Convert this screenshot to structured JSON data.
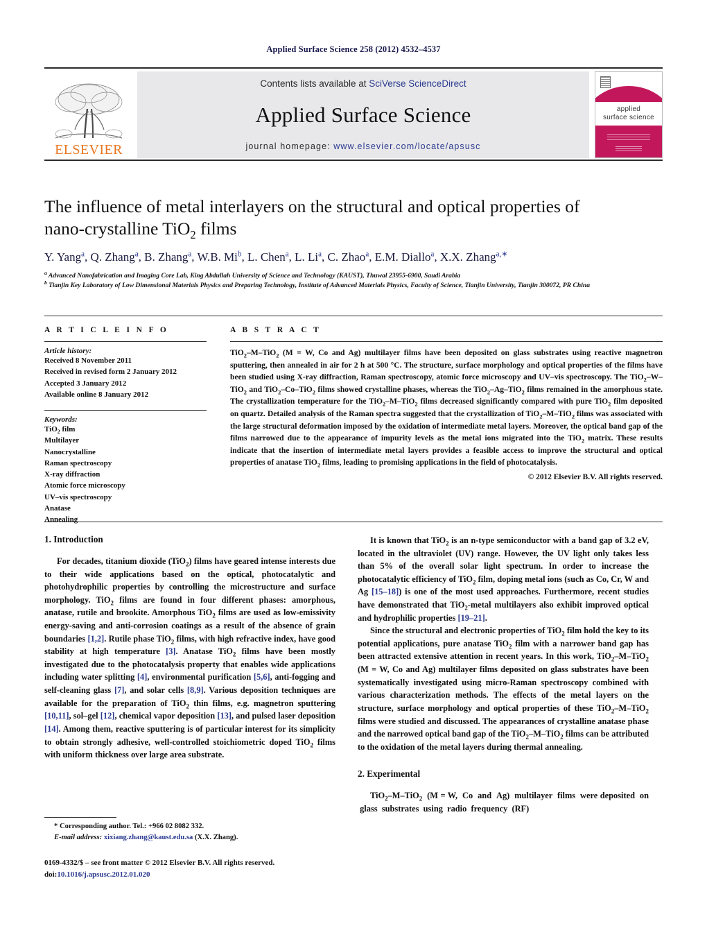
{
  "running_head": "Applied Surface Science 258 (2012) 4532–4537",
  "masthead": {
    "publisher_wordmark": "ELSEVIER",
    "contents_prefix": "Contents lists available at ",
    "contents_link": "SciVerse ScienceDirect",
    "journal_name": "Applied Surface Science",
    "homepage_prefix": "journal homepage: ",
    "homepage_url": "www.elsevier.com/locate/apsusc",
    "cover_title_line1": "applied",
    "cover_title_line2": "surface science"
  },
  "article": {
    "title_line1": "The influence of metal interlayers on the structural and optical properties of",
    "title_line2_pre": "nano-crystalline TiO",
    "title_line2_sub": "2",
    "title_line2_post": " films",
    "authors": "Y. Yang a, Q. Zhang a, B. Zhang a, W.B. Mi b, L. Chen a, L. Li a, C. Zhao a, E.M. Diallo a, X.X. Zhang a,*",
    "affiliation_a": "Advanced Nanofabrication and Imaging Core Lab, King Abdullah University of Science and Technology (KAUST), Thuwal 23955-6900, Saudi Arabia",
    "affiliation_b": "Tianjin Key Laboratory of Low Dimensional Materials Physics and Preparing Technology, Institute of Advanced Materials Physics, Faculty of Science, Tianjin University, Tianjin 300072, PR China"
  },
  "article_info": {
    "heading": "A R T I C L E   I N F O",
    "history_label": "Article history:",
    "history": [
      "Received 8 November 2011",
      "Received in revised form 2 January 2012",
      "Accepted 3 January 2012",
      "Available online 8 January 2012"
    ],
    "keywords_label": "Keywords:",
    "keywords": [
      "TiO2 film",
      "Multilayer",
      "Nanocrystalline",
      "Raman spectroscopy",
      "X-ray diffraction",
      "Atomic force microscopy",
      "UV–vis spectroscopy",
      "Anatase",
      "Annealing"
    ]
  },
  "abstract": {
    "heading": "A B S T R A C T",
    "text": "TiO2–M–TiO2 (M = W, Co and Ag) multilayer films have been deposited on glass substrates using reactive magnetron sputtering, then annealed in air for 2 h at 500 °C. The structure, surface morphology and optical properties of the films have been studied using X-ray diffraction, Raman spectroscopy, atomic force microscopy and UV–vis spectroscopy. The TiO2–W–TiO2 and TiO2–Co–TiO2 films showed crystalline phases, whereas the TiO2–Ag–TiO2 films remained in the amorphous state. The crystallization temperature for the TiO2–M–TiO2 films decreased significantly compared with pure TiO2 film deposited on quartz. Detailed analysis of the Raman spectra suggested that the crystallization of TiO2–M–TiO2 films was associated with the large structural deformation imposed by the oxidation of intermediate metal layers. Moreover, the optical band gap of the films narrowed due to the appearance of impurity levels as the metal ions migrated into the TiO2 matrix. These results indicate that the insertion of intermediate metal layers provides a feasible access to improve the structural and optical properties of anatase TiO2 films, leading to promising applications in the field of photocatalysis.",
    "copyright": "© 2012 Elsevier B.V. All rights reserved."
  },
  "sections": {
    "introduction_heading": "1.  Introduction",
    "experimental_heading": "2.  Experimental",
    "intro_para1": "For decades, titanium dioxide (TiO2) films have geared intense interests due to their wide applications based on the optical, photocatalytic and photohydrophilic properties by controlling the microstructure and surface morphology. TiO2 films are found in four different phases: amorphous, anatase, rutile and brookite. Amorphous TiO2 films are used as low-emissivity energy-saving and anti-corrosion coatings as a result of the absence of grain boundaries [1,2]. Rutile phase TiO2 films, with high refractive index, have good stability at high temperature [3]. Anatase TiO2 films have been mostly investigated due to the photocatalysis property that enables wide applications including water splitting [4], environmental purification [5,6], anti-fogging and self-cleaning glass [7], and solar cells [8,9]. Various deposition techniques are available for the preparation of TiO2 thin films, e.g. magnetron sputtering [10,11], sol–gel [12], chemical vapor deposition [13], and pulsed laser deposition [14]. Among them, reactive sputtering is of particular interest for its simplicity to obtain strongly adhesive, well-controlled stoichiometric doped TiO2 films with uniform thickness over large area substrate.",
    "intro_para2": "It is known that TiO2 is an n-type semiconductor with a band gap of 3.2 eV, located in the ultraviolet (UV) range. However, the UV light only takes less than 5% of the overall solar light spectrum. In order to increase the photocatalytic efficiency of TiO2 film, doping metal ions (such as Co, Cr, W and Ag [15–18]) is one of the most used approaches. Furthermore, recent studies have demonstrated that TiO2-metal multilayers also exhibit improved optical and hydrophilic properties [19–21].",
    "intro_para3": "Since the structural and electronic properties of TiO2 film hold the key to its potential applications, pure anatase TiO2 film with a narrower band gap has been attracted extensive attention in recent years. In this work, TiO2–M–TiO2 (M = W, Co and Ag) multilayer films deposited on glass substrates have been systematically investigated using micro-Raman spectroscopy combined with various characterization methods. The effects of the metal layers on the structure, surface morphology and optical properties of these TiO2–M–TiO2 films were studied and discussed. The appearances of crystalline anatase phase and the narrowed optical band gap of the TiO2–M–TiO2 films can be attributed to the oxidation of the metal layers during thermal annealing.",
    "experimental_para1": "TiO2–M–TiO2 (M = W, Co and Ag) multilayer films were deposited on glass substrates using radio frequency (RF)"
  },
  "footnotes": {
    "corresponding": "* Corresponding author. Tel.: +966 02 8082 332.",
    "email_label": "E-mail address:",
    "email": "xixiang.zhang@kaust.edu.sa",
    "email_attrib": "(X.X. Zhang).",
    "imprint": "0169-4332/$ – see front matter © 2012 Elsevier B.V. All rights reserved.",
    "doi_label": "doi:",
    "doi_value": "10.1016/j.apsusc.2012.01.020"
  },
  "colors": {
    "link": "#2b3a8f",
    "elsevier_orange": "#e87722",
    "cover_magenta": "#c2185b",
    "masthead_grey": "#e8e8ea"
  }
}
